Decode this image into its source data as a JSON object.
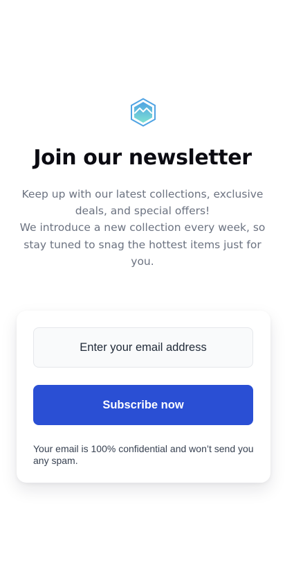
{
  "header": {
    "logo_icon": "mountain-hexagon-icon",
    "title": "Join our newsletter",
    "description_lines": [
      "Keep up with our latest collections, exclusive deals, and special offers!",
      "We introduce a new collection every week, so stay tuned to snag the hottest items just for you."
    ]
  },
  "form": {
    "email_placeholder": "Enter your email address",
    "email_value": "",
    "subscribe_label": "Subscribe now",
    "privacy_note": "Your email is 100% confidential and won’t send you any spam."
  },
  "colors": {
    "primary_button": "#2a4fd4",
    "logo_gradient_top": "#4fa3e3",
    "logo_gradient_bottom": "#7ee0d3",
    "text_muted": "#6b7280"
  }
}
